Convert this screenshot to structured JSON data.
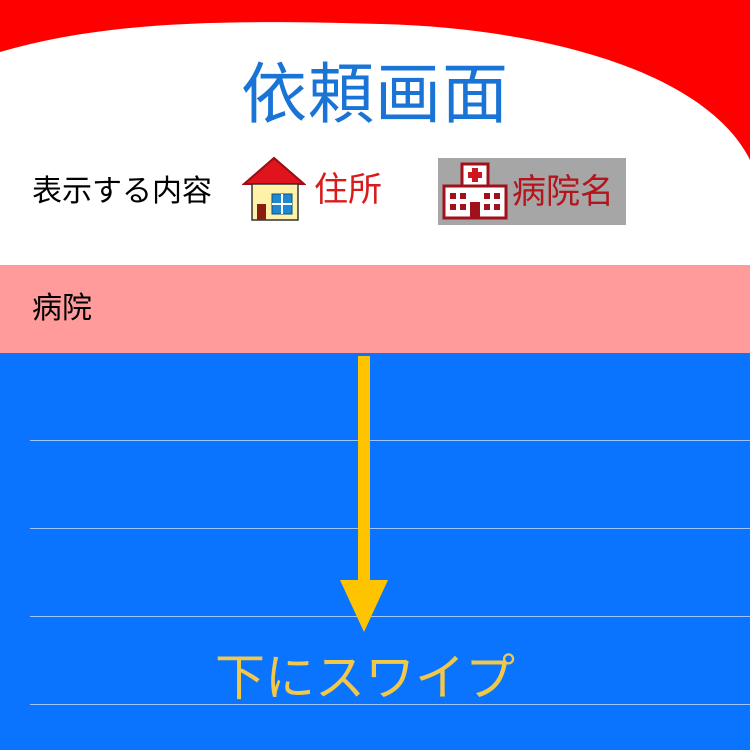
{
  "header": {
    "title": "依頼画面"
  },
  "display": {
    "label": "表示する内容",
    "options": [
      {
        "icon": "house-icon",
        "label": "住所",
        "selected": false
      },
      {
        "icon": "hospital-icon",
        "label": "病院名",
        "selected": true
      }
    ]
  },
  "section": {
    "label": "病院"
  },
  "list": {
    "rows": [
      "",
      "",
      "",
      ""
    ]
  },
  "hint": {
    "text": "下にスワイプ",
    "arrow": "arrow-down-icon"
  },
  "colors": {
    "accent_red": "#ff0000",
    "title_blue": "#1a74d6",
    "section_bg": "#ff9b9b",
    "list_bg": "#0a74ff",
    "hint_yellow": "#f2c84a",
    "selected_bg": "#a6a6a6"
  }
}
